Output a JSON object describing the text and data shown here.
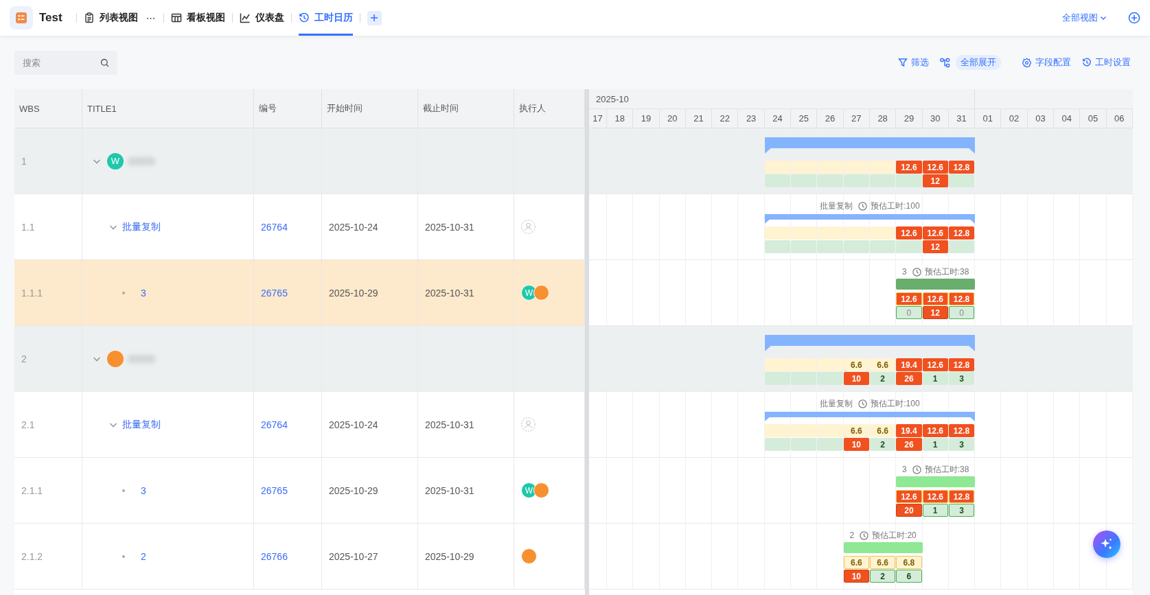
{
  "app": {
    "name": "Test"
  },
  "views": [
    {
      "label": "列表视图",
      "more": "⋯",
      "selected": false
    },
    {
      "label": "看板视图",
      "selected": false
    },
    {
      "label": "仪表盘",
      "selected": false
    },
    {
      "label": "工时日历",
      "selected": true
    }
  ],
  "all_views": "全部视图",
  "search": {
    "placeholder": "搜索"
  },
  "actions": [
    {
      "label": "筛选",
      "kind": "link"
    },
    {
      "label": "全部展开",
      "kind": "pill"
    },
    {
      "label": "字段配置",
      "kind": "link"
    },
    {
      "label": "工时设置",
      "kind": "link"
    }
  ],
  "columns": [
    "WBS",
    "TITLE1",
    "编号",
    "开始时间",
    "截止时间",
    "执行人"
  ],
  "month": "2025-10",
  "days": [
    "17",
    "18",
    "19",
    "20",
    "21",
    "22",
    "23",
    "24",
    "25",
    "26",
    "27",
    "28",
    "29",
    "30",
    "31",
    "01",
    "02",
    "03",
    "04",
    "05",
    "06"
  ],
  "rows": [
    {
      "wbs": "1",
      "kind": "group",
      "expanded": true,
      "selected": false,
      "avatar": {
        "text": "W",
        "color": "#1fc8a9"
      },
      "gantt": {
        "bar": {
          "kind": "summary",
          "color": "#85b4ff"
        },
        "bordered": false,
        "days": [
          {
            "kind": "off"
          },
          {
            "kind": "off"
          },
          {
            "kind": "off"
          },
          {
            "kind": "off"
          },
          {
            "kind": "off"
          },
          {
            "kind": "off"
          },
          {
            "kind": "off"
          },
          {
            "kind": "work",
            "plan": {
              "kind": "blank"
            },
            "actual": {
              "kind": "blank"
            }
          },
          {
            "kind": "work",
            "plan": {
              "kind": "blank"
            },
            "actual": {
              "kind": "blank"
            }
          },
          {
            "kind": "work",
            "plan": {
              "kind": "blank"
            },
            "actual": {
              "kind": "blank"
            }
          },
          {
            "kind": "work",
            "plan": {
              "kind": "blank"
            },
            "actual": {
              "kind": "blank"
            }
          },
          {
            "kind": "work",
            "plan": {
              "kind": "blank"
            },
            "actual": {
              "kind": "blank"
            }
          },
          {
            "kind": "work",
            "plan": {
              "kind": "over",
              "value": "12.6"
            },
            "actual": {
              "kind": "blank"
            }
          },
          {
            "kind": "work",
            "plan": {
              "kind": "over",
              "value": "12.6"
            },
            "actual": {
              "kind": "over",
              "value": "12"
            }
          },
          {
            "kind": "work",
            "plan": {
              "kind": "over",
              "value": "12.8"
            },
            "actual": {
              "kind": "blank"
            }
          },
          {
            "kind": "off"
          },
          {
            "kind": "off"
          },
          {
            "kind": "off"
          },
          {
            "kind": "off"
          },
          {
            "kind": "off"
          },
          {
            "kind": "off"
          }
        ]
      }
    },
    {
      "wbs": "1.1",
      "kind": "parent",
      "expanded": true,
      "selected": false,
      "title": "批量复制",
      "code": "26764",
      "start": "2025-10-24",
      "end": "2025-10-31",
      "unassigned": true,
      "gantt": {
        "label": {
          "title": "批量复制",
          "estimate": "预估工时:100"
        },
        "bar": {
          "kind": "summary",
          "color": "#85b4ff"
        },
        "bordered": false,
        "days": [
          {
            "kind": "off"
          },
          {
            "kind": "off"
          },
          {
            "kind": "off"
          },
          {
            "kind": "off"
          },
          {
            "kind": "off"
          },
          {
            "kind": "off"
          },
          {
            "kind": "off"
          },
          {
            "kind": "work",
            "plan": {
              "kind": "blank"
            },
            "actual": {
              "kind": "blank"
            }
          },
          {
            "kind": "work",
            "plan": {
              "kind": "blank"
            },
            "actual": {
              "kind": "blank"
            }
          },
          {
            "kind": "work",
            "plan": {
              "kind": "blank"
            },
            "actual": {
              "kind": "blank"
            }
          },
          {
            "kind": "work",
            "plan": {
              "kind": "blank"
            },
            "actual": {
              "kind": "blank"
            }
          },
          {
            "kind": "work",
            "plan": {
              "kind": "blank"
            },
            "actual": {
              "kind": "blank"
            }
          },
          {
            "kind": "work",
            "plan": {
              "kind": "over",
              "value": "12.6"
            },
            "actual": {
              "kind": "blank"
            }
          },
          {
            "kind": "work",
            "plan": {
              "kind": "over",
              "value": "12.6"
            },
            "actual": {
              "kind": "over",
              "value": "12"
            }
          },
          {
            "kind": "work",
            "plan": {
              "kind": "over",
              "value": "12.8"
            },
            "actual": {
              "kind": "blank"
            }
          },
          {
            "kind": "off"
          },
          {
            "kind": "off"
          },
          {
            "kind": "off"
          },
          {
            "kind": "off"
          },
          {
            "kind": "off"
          },
          {
            "kind": "off"
          }
        ]
      }
    },
    {
      "wbs": "1.1.1",
      "kind": "leaf",
      "selected": true,
      "title": "3",
      "code": "26765",
      "start": "2025-10-29",
      "end": "2025-10-31",
      "assignees": [
        {
          "text": "W",
          "color": "#1fc8a9"
        },
        {
          "color": "#f7902f"
        }
      ],
      "gantt": {
        "label": {
          "title": "3",
          "estimate": "预估工时:38"
        },
        "bar": {
          "kind": "task",
          "color": "#69ad6f"
        },
        "bordered": true,
        "days": [
          {
            "kind": "off"
          },
          {
            "kind": "off"
          },
          {
            "kind": "off"
          },
          {
            "kind": "off"
          },
          {
            "kind": "off"
          },
          {
            "kind": "off"
          },
          {
            "kind": "off"
          },
          {
            "kind": "off"
          },
          {
            "kind": "off"
          },
          {
            "kind": "off"
          },
          {
            "kind": "off"
          },
          {
            "kind": "off"
          },
          {
            "kind": "work",
            "plan": {
              "kind": "over",
              "value": "12.6"
            },
            "actual": {
              "kind": "zero",
              "value": "0"
            }
          },
          {
            "kind": "work",
            "plan": {
              "kind": "over",
              "value": "12.6"
            },
            "actual": {
              "kind": "over",
              "value": "12"
            }
          },
          {
            "kind": "work",
            "plan": {
              "kind": "over",
              "value": "12.8"
            },
            "actual": {
              "kind": "zero",
              "value": "0"
            }
          },
          {
            "kind": "off"
          },
          {
            "kind": "off"
          },
          {
            "kind": "off"
          },
          {
            "kind": "off"
          },
          {
            "kind": "off"
          },
          {
            "kind": "off"
          }
        ]
      }
    },
    {
      "wbs": "2",
      "kind": "group",
      "expanded": true,
      "selected": false,
      "avatar": {
        "color": "#f7902f"
      },
      "gantt": {
        "bar": {
          "kind": "summary",
          "color": "#85b4ff"
        },
        "bordered": false,
        "days": [
          {
            "kind": "off"
          },
          {
            "kind": "off"
          },
          {
            "kind": "off"
          },
          {
            "kind": "off"
          },
          {
            "kind": "off"
          },
          {
            "kind": "off"
          },
          {
            "kind": "off"
          },
          {
            "kind": "work",
            "plan": {
              "kind": "blank"
            },
            "actual": {
              "kind": "blank"
            }
          },
          {
            "kind": "work",
            "plan": {
              "kind": "blank"
            },
            "actual": {
              "kind": "blank"
            }
          },
          {
            "kind": "work",
            "plan": {
              "kind": "blank"
            },
            "actual": {
              "kind": "blank"
            }
          },
          {
            "kind": "work",
            "plan": {
              "kind": "ok",
              "value": "6.6"
            },
            "actual": {
              "kind": "over",
              "value": "10"
            }
          },
          {
            "kind": "work",
            "plan": {
              "kind": "ok",
              "value": "6.6"
            },
            "actual": {
              "kind": "ok",
              "value": "2"
            }
          },
          {
            "kind": "work",
            "plan": {
              "kind": "over",
              "value": "19.4"
            },
            "actual": {
              "kind": "over",
              "value": "26"
            }
          },
          {
            "kind": "work",
            "plan": {
              "kind": "over",
              "value": "12.6"
            },
            "actual": {
              "kind": "ok",
              "value": "1"
            }
          },
          {
            "kind": "work",
            "plan": {
              "kind": "over",
              "value": "12.8"
            },
            "actual": {
              "kind": "ok",
              "value": "3"
            }
          },
          {
            "kind": "off"
          },
          {
            "kind": "off"
          },
          {
            "kind": "off"
          },
          {
            "kind": "off"
          },
          {
            "kind": "off"
          },
          {
            "kind": "off"
          }
        ]
      }
    },
    {
      "wbs": "2.1",
      "kind": "parent",
      "expanded": true,
      "selected": false,
      "title": "批量复制",
      "code": "26764",
      "start": "2025-10-24",
      "end": "2025-10-31",
      "unassigned": true,
      "gantt": {
        "label": {
          "title": "批量复制",
          "estimate": "预估工时:100"
        },
        "bar": {
          "kind": "summary",
          "color": "#85b4ff"
        },
        "bordered": false,
        "days": [
          {
            "kind": "off"
          },
          {
            "kind": "off"
          },
          {
            "kind": "off"
          },
          {
            "kind": "off"
          },
          {
            "kind": "off"
          },
          {
            "kind": "off"
          },
          {
            "kind": "off"
          },
          {
            "kind": "work",
            "plan": {
              "kind": "blank"
            },
            "actual": {
              "kind": "blank"
            }
          },
          {
            "kind": "work",
            "plan": {
              "kind": "blank"
            },
            "actual": {
              "kind": "blank"
            }
          },
          {
            "kind": "work",
            "plan": {
              "kind": "blank"
            },
            "actual": {
              "kind": "blank"
            }
          },
          {
            "kind": "work",
            "plan": {
              "kind": "ok",
              "value": "6.6"
            },
            "actual": {
              "kind": "over",
              "value": "10"
            }
          },
          {
            "kind": "work",
            "plan": {
              "kind": "ok",
              "value": "6.6"
            },
            "actual": {
              "kind": "ok",
              "value": "2"
            }
          },
          {
            "kind": "work",
            "plan": {
              "kind": "over",
              "value": "19.4"
            },
            "actual": {
              "kind": "over",
              "value": "26"
            }
          },
          {
            "kind": "work",
            "plan": {
              "kind": "over",
              "value": "12.6"
            },
            "actual": {
              "kind": "ok",
              "value": "1"
            }
          },
          {
            "kind": "work",
            "plan": {
              "kind": "over",
              "value": "12.8"
            },
            "actual": {
              "kind": "ok",
              "value": "3"
            }
          },
          {
            "kind": "off"
          },
          {
            "kind": "off"
          },
          {
            "kind": "off"
          },
          {
            "kind": "off"
          },
          {
            "kind": "off"
          },
          {
            "kind": "off"
          }
        ]
      }
    },
    {
      "wbs": "2.1.1",
      "kind": "leaf",
      "selected": false,
      "title": "3",
      "code": "26765",
      "start": "2025-10-29",
      "end": "2025-10-31",
      "assignees": [
        {
          "text": "W",
          "color": "#1fc8a9"
        },
        {
          "color": "#f7902f"
        }
      ],
      "gantt": {
        "label": {
          "title": "3",
          "estimate": "预估工时:38"
        },
        "bar": {
          "kind": "task",
          "color": "#8ee894"
        },
        "bordered": true,
        "days": [
          {
            "kind": "off"
          },
          {
            "kind": "off"
          },
          {
            "kind": "off"
          },
          {
            "kind": "off"
          },
          {
            "kind": "off"
          },
          {
            "kind": "off"
          },
          {
            "kind": "off"
          },
          {
            "kind": "off"
          },
          {
            "kind": "off"
          },
          {
            "kind": "off"
          },
          {
            "kind": "off"
          },
          {
            "kind": "off"
          },
          {
            "kind": "work",
            "plan": {
              "kind": "over",
              "value": "12.6"
            },
            "actual": {
              "kind": "over",
              "value": "20"
            }
          },
          {
            "kind": "work",
            "plan": {
              "kind": "over",
              "value": "12.6"
            },
            "actual": {
              "kind": "ok",
              "value": "1"
            }
          },
          {
            "kind": "work",
            "plan": {
              "kind": "over",
              "value": "12.8"
            },
            "actual": {
              "kind": "ok",
              "value": "3"
            }
          },
          {
            "kind": "off"
          },
          {
            "kind": "off"
          },
          {
            "kind": "off"
          },
          {
            "kind": "off"
          },
          {
            "kind": "off"
          },
          {
            "kind": "off"
          }
        ]
      }
    },
    {
      "wbs": "2.1.2",
      "kind": "leaf",
      "selected": false,
      "title": "2",
      "code": "26766",
      "start": "2025-10-27",
      "end": "2025-10-29",
      "assignees": [
        {
          "color": "#f7902f"
        }
      ],
      "gantt": {
        "label": {
          "title": "2",
          "estimate": "预估工时:20"
        },
        "bar": {
          "kind": "task",
          "color": "#8ee894"
        },
        "bordered": true,
        "days": [
          {
            "kind": "off"
          },
          {
            "kind": "off"
          },
          {
            "kind": "off"
          },
          {
            "kind": "off"
          },
          {
            "kind": "off"
          },
          {
            "kind": "off"
          },
          {
            "kind": "off"
          },
          {
            "kind": "off"
          },
          {
            "kind": "off"
          },
          {
            "kind": "off"
          },
          {
            "kind": "work",
            "plan": {
              "kind": "ok",
              "value": "6.6"
            },
            "actual": {
              "kind": "over",
              "value": "10"
            }
          },
          {
            "kind": "work",
            "plan": {
              "kind": "ok",
              "value": "6.6"
            },
            "actual": {
              "kind": "ok",
              "value": "2"
            }
          },
          {
            "kind": "work",
            "plan": {
              "kind": "ok",
              "value": "6.8"
            },
            "actual": {
              "kind": "ok",
              "value": "6"
            }
          },
          {
            "kind": "off"
          },
          {
            "kind": "off"
          },
          {
            "kind": "off"
          },
          {
            "kind": "off"
          },
          {
            "kind": "off"
          },
          {
            "kind": "off"
          },
          {
            "kind": "off"
          },
          {
            "kind": "off"
          }
        ]
      }
    }
  ]
}
